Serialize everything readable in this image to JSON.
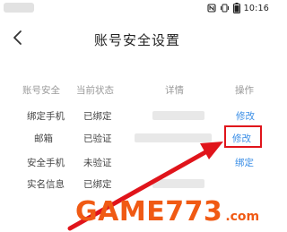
{
  "status_bar": {
    "time": "10:16",
    "icons": [
      "nfc-icon",
      "vibrate-icon",
      "battery-icon"
    ]
  },
  "nav": {
    "title": "账号安全设置",
    "back_icon": "chevron-left-icon"
  },
  "table": {
    "headers": [
      "账号安全",
      "当前状态",
      "详情",
      "操作"
    ],
    "rows": [
      {
        "item": "绑定手机",
        "status": "已绑定",
        "action": "修改"
      },
      {
        "item": "邮箱",
        "status": "已验证",
        "action": "修改"
      },
      {
        "item": "安全手机",
        "status": "未验证",
        "action": "绑定"
      },
      {
        "item": "实名信息",
        "status": "已绑定",
        "action": ""
      }
    ]
  },
  "annotation": {
    "color": "#e0141b"
  },
  "watermark": {
    "main": "GAME773",
    "suffix": ".com",
    "color": "#f05a14"
  },
  "colors": {
    "link": "#3a8ee6",
    "header_text": "#9a9a9a",
    "body_text": "#444444"
  }
}
